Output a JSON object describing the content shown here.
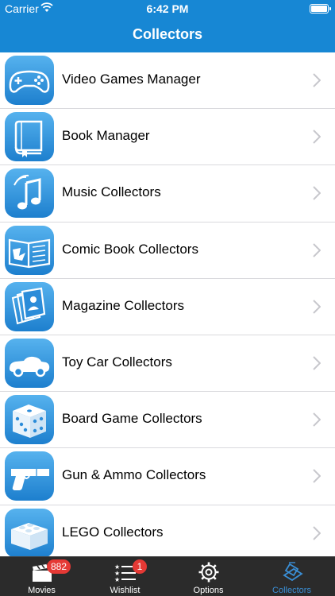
{
  "status_bar": {
    "carrier": "Carrier",
    "time": "6:42 PM"
  },
  "nav": {
    "title": "Collectors"
  },
  "collectors": [
    {
      "label": "Video Games Manager",
      "icon": "gamepad-icon"
    },
    {
      "label": "Book Manager",
      "icon": "book-icon"
    },
    {
      "label": "Music Collectors",
      "icon": "music-note-icon"
    },
    {
      "label": "Comic Book Collectors",
      "icon": "comic-book-icon"
    },
    {
      "label": "Magazine Collectors",
      "icon": "magazine-icon"
    },
    {
      "label": "Toy Car Collectors",
      "icon": "toy-car-icon"
    },
    {
      "label": "Board Game Collectors",
      "icon": "dice-icon"
    },
    {
      "label": "Gun & Ammo Collectors",
      "icon": "pistol-icon"
    },
    {
      "label": "LEGO Collectors",
      "icon": "lego-brick-icon"
    }
  ],
  "tabs": [
    {
      "label": "Movies",
      "badge": "882",
      "icon": "clapperboard-icon"
    },
    {
      "label": "Wishlist",
      "badge": "1",
      "icon": "star-list-icon"
    },
    {
      "label": "Options",
      "icon": "gear-icon"
    },
    {
      "label": "Collectors",
      "icon": "collectors-icon",
      "active": true
    }
  ],
  "colors": {
    "nav_bar": "#1787d4",
    "tab_bar": "#2b2b2b",
    "active_tab": "#3a8fd6",
    "badge": "#e53935"
  }
}
